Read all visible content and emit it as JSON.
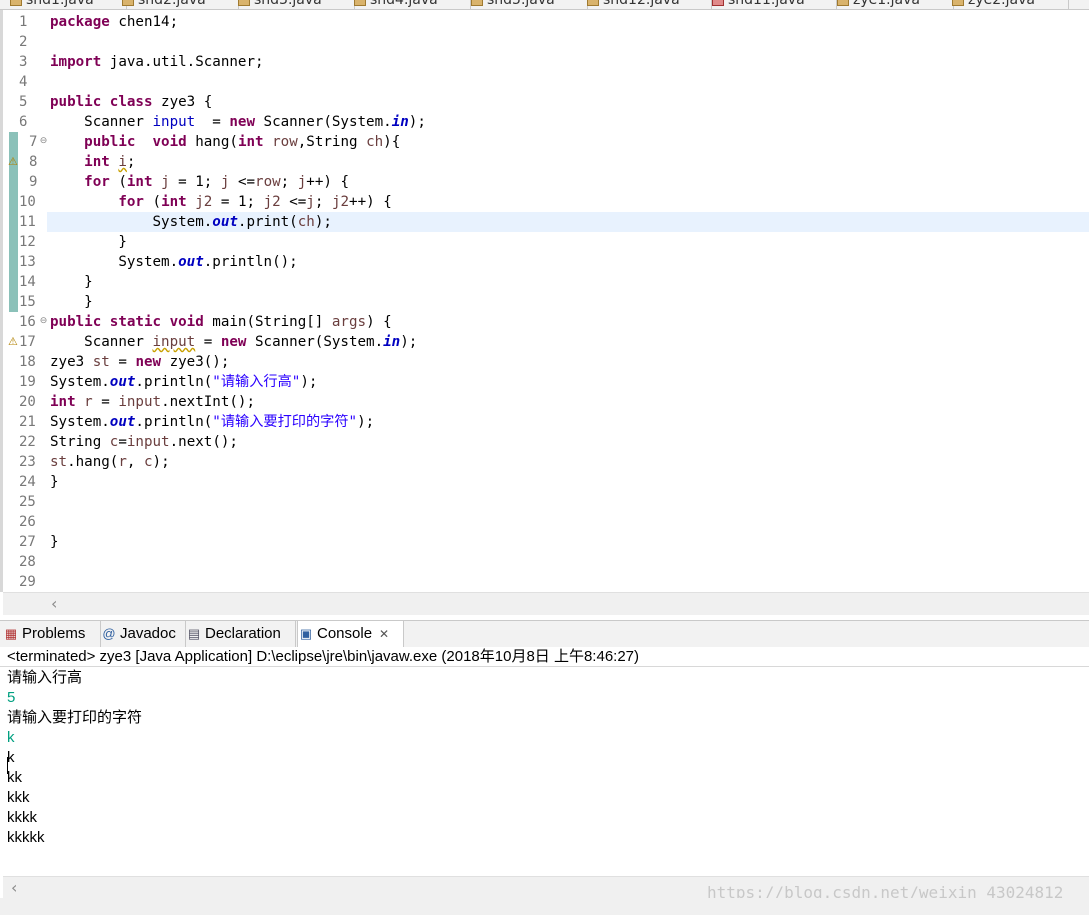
{
  "editor_tabs": [
    "shd1.java",
    "shd2.java",
    "shd3.java",
    "shd4.java",
    "shd5.java",
    "shd12.java",
    "shd11.java",
    "zye1.java",
    "zye2.java"
  ],
  "code_lines": [
    {
      "n": "1",
      "t": "package chen14;"
    },
    {
      "n": "2",
      "t": ""
    },
    {
      "n": "3",
      "t": "import java.util.Scanner;"
    },
    {
      "n": "4",
      "t": ""
    },
    {
      "n": "5",
      "t": "public class zye3 {"
    },
    {
      "n": "6",
      "t": "    Scanner input  = new Scanner(System.in);"
    },
    {
      "n": "7",
      "t": "    public  void hang(int row,String ch){"
    },
    {
      "n": "8",
      "t": "    int i;"
    },
    {
      "n": "9",
      "t": "    for (int j = 1; j <=row; j++) {"
    },
    {
      "n": "10",
      "t": "        for (int j2 = 1; j2 <=j; j2++) {"
    },
    {
      "n": "11",
      "t": "            System.out.print(ch);"
    },
    {
      "n": "12",
      "t": "        }"
    },
    {
      "n": "13",
      "t": "        System.out.println();"
    },
    {
      "n": "14",
      "t": "    }"
    },
    {
      "n": "15",
      "t": "    }"
    },
    {
      "n": "16",
      "t": "public static void main(String[] args) {"
    },
    {
      "n": "17",
      "t": "    Scanner input = new Scanner(System.in);"
    },
    {
      "n": "18",
      "t": "zye3 st = new zye3();"
    },
    {
      "n": "19",
      "t": "System.out.println(\"请输入行高\");"
    },
    {
      "n": "20",
      "t": "int r = input.nextInt();"
    },
    {
      "n": "21",
      "t": "System.out.println(\"请输入要打印的字符\");"
    },
    {
      "n": "22",
      "t": "String c=input.next();"
    },
    {
      "n": "23",
      "t": "st.hang(r, c);"
    },
    {
      "n": "24",
      "t": "}"
    },
    {
      "n": "25",
      "t": ""
    },
    {
      "n": "26",
      "t": ""
    },
    {
      "n": "27",
      "t": "}"
    },
    {
      "n": "28",
      "t": ""
    },
    {
      "n": "29",
      "t": ""
    }
  ],
  "views": {
    "problems": "Problems",
    "javadoc": "Javadoc",
    "declaration": "Declaration",
    "console": "Console",
    "problems_icon": "problems-icon",
    "javadoc_icon": "at-icon",
    "declaration_icon": "declaration-icon",
    "console_icon": "console-icon"
  },
  "console": {
    "header": "<terminated> zye3 [Java Application] D:\\eclipse\\jre\\bin\\javaw.exe (2018年10月8日 上午8:46:27)",
    "lines": [
      {
        "text": "请输入行高",
        "kind": "out"
      },
      {
        "text": "5",
        "kind": "in"
      },
      {
        "text": "请输入要打印的字符",
        "kind": "out"
      },
      {
        "text": "k",
        "kind": "in"
      },
      {
        "text": "k",
        "kind": "out"
      },
      {
        "text": "kk",
        "kind": "out"
      },
      {
        "text": "kkk",
        "kind": "out"
      },
      {
        "text": "kkkk",
        "kind": "out"
      },
      {
        "text": "kkkkk",
        "kind": "out"
      }
    ]
  },
  "watermark": "https://blog.csdn.net/weixin_43024812",
  "colors": {
    "keyword": "#7f0055",
    "string": "#2a00ff",
    "field": "#0000c0",
    "stdin": "#00a080",
    "current_line": "#e8f2fe"
  }
}
